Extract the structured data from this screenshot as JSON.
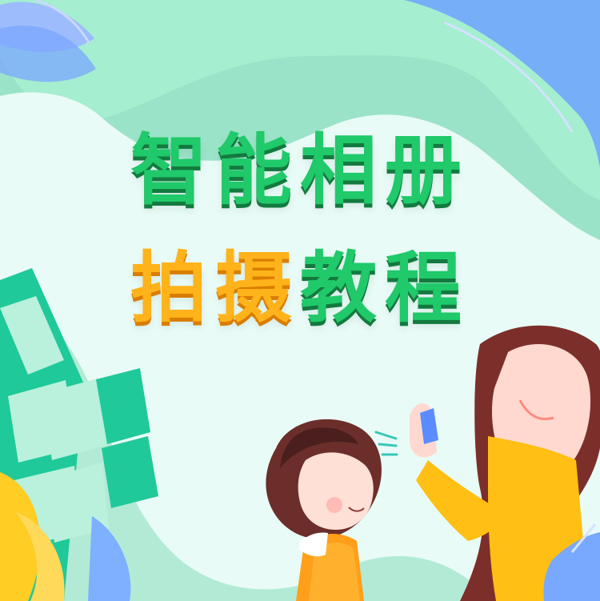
{
  "title": {
    "line1": "智能相册",
    "line2_highlight": "拍摄",
    "line2_rest": "教程"
  },
  "colors": {
    "title_green": "#20c96a",
    "title_orange": "#ffb31a",
    "background_mint": "#e8fbf6",
    "outer_green": "#9be3c8",
    "hair_brown": "#7c2f2a",
    "shirt_yellow": "#f7c300",
    "dress_orange": "#ff9f1a"
  }
}
